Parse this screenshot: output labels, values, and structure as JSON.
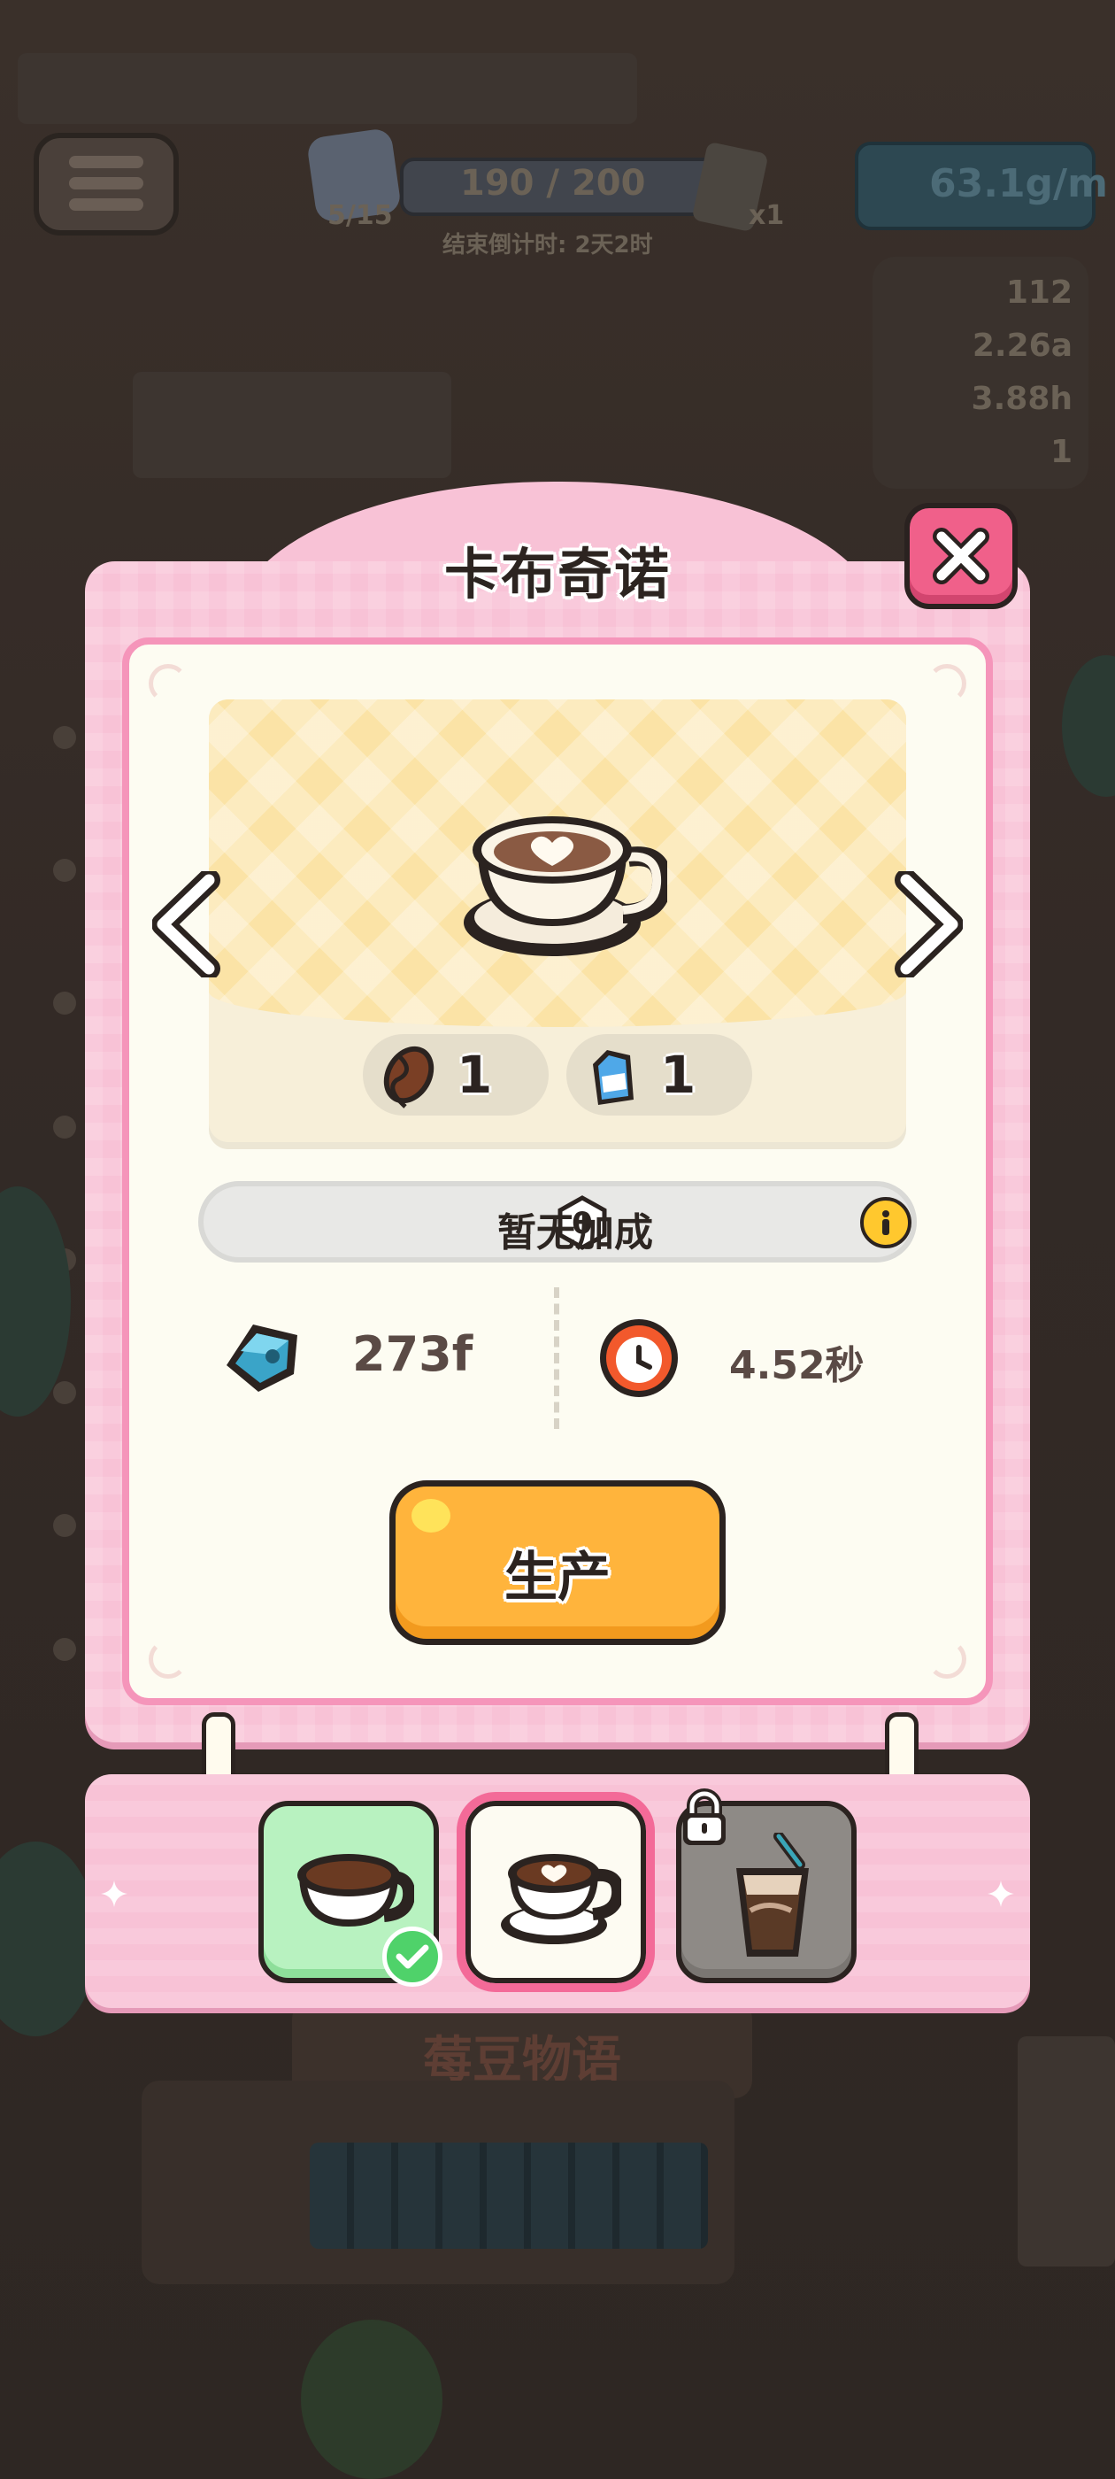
{
  "hud": {
    "level_count": "5/15",
    "crown_progress": "190 / 200",
    "timer_text": "结束倒计时: 2天2时",
    "ticket_count": "x1",
    "rate": "63.1g/m",
    "stats": [
      "112",
      "2.26a",
      "3.88h",
      "1"
    ],
    "shop_sign": "莓豆物语"
  },
  "panel": {
    "title": "卡布奇诺",
    "close_icon": "close-icon"
  },
  "recipe": {
    "product_icon": "cappuccino-cup-icon",
    "ingredients": [
      {
        "icon": "coffee-bean-icon",
        "qty": "1"
      },
      {
        "icon": "milk-carton-icon",
        "qty": "1"
      }
    ]
  },
  "bonus": {
    "count": "0",
    "label": "暂无加成",
    "info_icon": "info-icon"
  },
  "stats": {
    "value_text": "273f",
    "value_icon": "blue-gem-icon",
    "time_text": "4.52秒",
    "time_icon": "clock-icon"
  },
  "action": {
    "produce_label": "生产"
  },
  "selector": {
    "items": [
      {
        "name": "coffee",
        "state": "completed"
      },
      {
        "name": "cappuccino",
        "state": "selected"
      },
      {
        "name": "iced-coffee",
        "state": "locked"
      }
    ]
  },
  "colors": {
    "panel_pink": "#f8c2d6",
    "accent_pink": "#f36a98",
    "button_orange": "#ffb43c",
    "done_green": "#b8f2c0"
  }
}
